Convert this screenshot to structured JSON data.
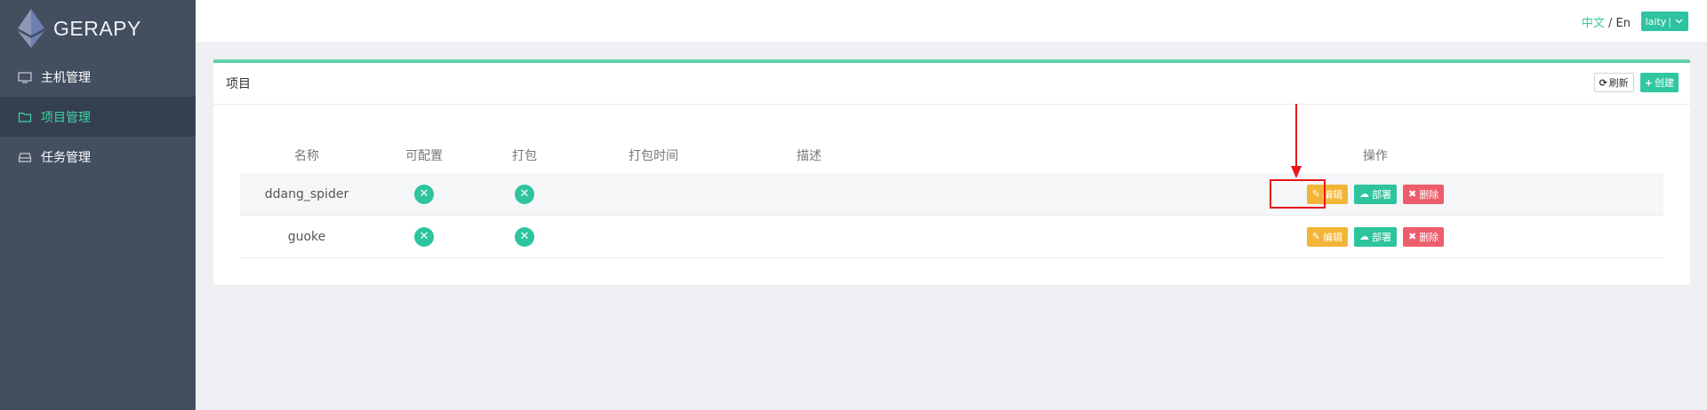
{
  "app": {
    "brand_name": "GERAPY"
  },
  "sidebar": {
    "items": [
      {
        "label": "主机管理",
        "icon": "monitor-icon",
        "active": false
      },
      {
        "label": "项目管理",
        "icon": "folder-icon",
        "active": true
      },
      {
        "label": "任务管理",
        "icon": "inbox-icon",
        "active": false
      }
    ]
  },
  "header": {
    "lang_zh": "中文",
    "lang_sep": " / ",
    "lang_en": "En",
    "user_name": "laity",
    "user_divider": "|"
  },
  "panel": {
    "title": "项目",
    "refresh_label": "刷新",
    "create_label": "创建"
  },
  "table": {
    "columns": [
      "名称",
      "可配置",
      "打包",
      "打包时间",
      "描述",
      "操作"
    ],
    "rows": [
      {
        "name": "ddang_spider",
        "configurable": false,
        "packaged": false,
        "pack_time": "",
        "description": ""
      },
      {
        "name": "guoke",
        "configurable": false,
        "packaged": false,
        "pack_time": "",
        "description": ""
      }
    ],
    "actions": {
      "edit": "编辑",
      "deploy": "部署",
      "delete": "删除"
    }
  },
  "colors": {
    "sidebar_bg": "#434f5f",
    "accent": "#2ec49e",
    "edit": "#f3b537",
    "delete": "#ee5d6c",
    "annotation": "#e8161c"
  }
}
